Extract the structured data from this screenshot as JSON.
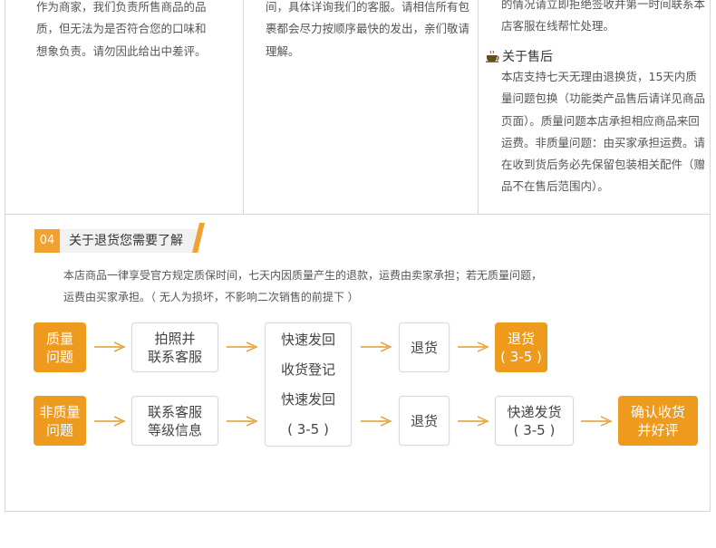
{
  "top_columns": {
    "col1": {
      "lines": [
        "作为商家，我们负责所售商品的品",
        "质，但无法为是否符合您的口味和",
        "想象负责。请勿因此给出中差评。"
      ]
    },
    "col2": {
      "lines": [
        "间，具体详询我们的客服。请相信所有包",
        "裹都会尽力按顺序最快的发出，亲们敬请",
        "理解。"
      ]
    },
    "col3": {
      "lines": [
        "的情况请立即拒绝签收并第一时间联系本",
        "店客服在线帮忙处理。"
      ],
      "after_sales_title": "关于售后",
      "after_sales_icon": "coffee-cup-icon",
      "after_sales_lines": [
        "本店支持七天无理由退换货，15天内质",
        "量问题包换（功能类产品售后请详见商品",
        "页面）。质量问题本店承担相应商品来回",
        "运费。非质量问题：由买家承担运费。请",
        "在收到货后务必先保留包装相关配件（赠",
        "品不在售后范围内）。"
      ]
    }
  },
  "section": {
    "number": "04",
    "title": "关于退货您需要了解",
    "paragraph_lines": [
      "本店商品一律享受官方规定质保时间，七天内因质量产生的退款，运费由卖家承担；若无质量问题，",
      "运费由买家承担。（ 无人为损坏，不影响二次销售的前提下 ）"
    ]
  },
  "flow": {
    "row1": {
      "start": [
        "质量",
        "问题"
      ],
      "step1": [
        "拍照并",
        "联系客服"
      ],
      "step3": "退货",
      "end": [
        "退货",
        "( 3-5 )"
      ]
    },
    "row2": {
      "start": [
        "非质量",
        "问题"
      ],
      "step1": [
        "联系客服",
        "等级信息"
      ],
      "step3": "退货",
      "step4": [
        "快递发货",
        "( 3-5 )"
      ],
      "end": [
        "确认收货",
        "并好评"
      ]
    },
    "shared": [
      "快速发回",
      "收货登记",
      "快速发回",
      "( 3-5 )"
    ]
  },
  "colors": {
    "accent": "#ed9a1d",
    "border": "#d6d6d6",
    "arrow": "#e59a2a"
  }
}
